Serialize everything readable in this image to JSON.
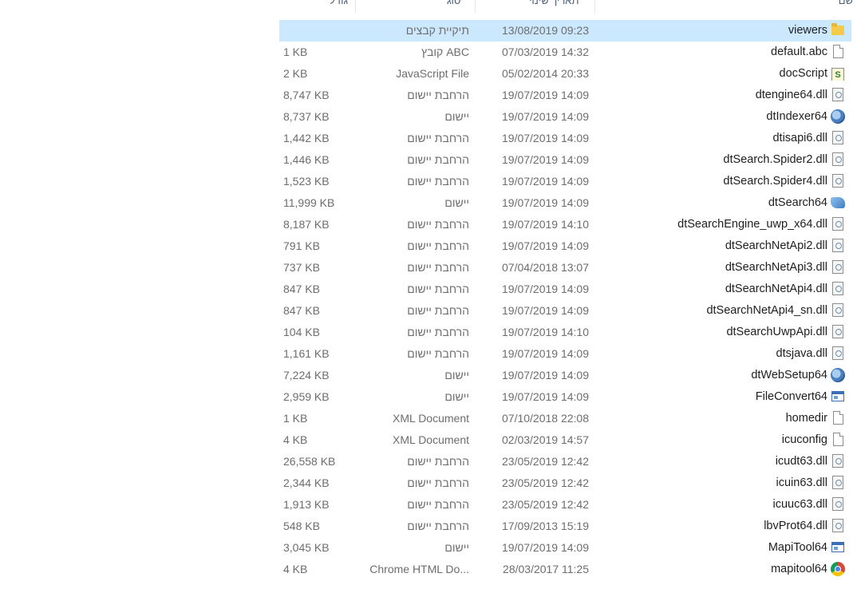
{
  "header": {
    "name": "שם",
    "date_modified": "תאריך שינוי",
    "type": "סוג",
    "size": "גודל"
  },
  "files": [
    {
      "name": "viewers",
      "date": "13/08/2019 09:23",
      "type": "תיקיית קבצים",
      "size": "",
      "icon": "folder-icon",
      "selected": true
    },
    {
      "name": "default.abc",
      "date": "07/03/2019 14:32",
      "type": "קובץ ABC",
      "size": "1 KB",
      "icon": "file-icon"
    },
    {
      "name": "docScript",
      "date": "05/02/2014 20:33",
      "type": "JavaScript File",
      "size": "2 KB",
      "icon": "script-icon"
    },
    {
      "name": "dtengine64.dll",
      "date": "19/07/2019 14:09",
      "type": "הרחבת יישום",
      "size": "8,747 KB",
      "icon": "dll-icon"
    },
    {
      "name": "dtIndexer64",
      "date": "19/07/2019 14:09",
      "type": "יישום",
      "size": "8,737 KB",
      "icon": "gear-app-icon"
    },
    {
      "name": "dtisapi6.dll",
      "date": "19/07/2019 14:09",
      "type": "הרחבת יישום",
      "size": "1,442 KB",
      "icon": "dll-icon"
    },
    {
      "name": "dtSearch.Spider2.dll",
      "date": "19/07/2019 14:09",
      "type": "הרחבת יישום",
      "size": "1,446 KB",
      "icon": "dll-icon"
    },
    {
      "name": "dtSearch.Spider4.dll",
      "date": "19/07/2019 14:09",
      "type": "הרחבת יישום",
      "size": "1,523 KB",
      "icon": "dll-icon"
    },
    {
      "name": "dtSearch64",
      "date": "19/07/2019 14:09",
      "type": "יישום",
      "size": "11,999 KB",
      "icon": "search-app-icon"
    },
    {
      "name": "dtSearchEngine_uwp_x64.dll",
      "date": "19/07/2019 14:10",
      "type": "הרחבת יישום",
      "size": "8,187 KB",
      "icon": "dll-icon"
    },
    {
      "name": "dtSearchNetApi2.dll",
      "date": "19/07/2019 14:09",
      "type": "הרחבת יישום",
      "size": "791 KB",
      "icon": "dll-icon"
    },
    {
      "name": "dtSearchNetApi3.dll",
      "date": "07/04/2018 13:07",
      "type": "הרחבת יישום",
      "size": "737 KB",
      "icon": "dll-icon"
    },
    {
      "name": "dtSearchNetApi4.dll",
      "date": "19/07/2019 14:09",
      "type": "הרחבת יישום",
      "size": "847 KB",
      "icon": "dll-icon"
    },
    {
      "name": "dtSearchNetApi4_sn.dll",
      "date": "19/07/2019 14:09",
      "type": "הרחבת יישום",
      "size": "847 KB",
      "icon": "dll-icon"
    },
    {
      "name": "dtSearchUwpApi.dll",
      "date": "19/07/2019 14:10",
      "type": "הרחבת יישום",
      "size": "104 KB",
      "icon": "dll-icon"
    },
    {
      "name": "dtsjava.dll",
      "date": "19/07/2019 14:09",
      "type": "הרחבת יישום",
      "size": "1,161 KB",
      "icon": "dll-icon"
    },
    {
      "name": "dtWebSetup64",
      "date": "19/07/2019 14:09",
      "type": "יישום",
      "size": "7,224 KB",
      "icon": "gear-app-icon"
    },
    {
      "name": "FileConvert64",
      "date": "19/07/2019 14:09",
      "type": "יישום",
      "size": "2,959 KB",
      "icon": "window-app-icon"
    },
    {
      "name": "homedir",
      "date": "07/10/2018 22:08",
      "type": "XML Document",
      "size": "1 KB",
      "icon": "file-icon"
    },
    {
      "name": "icuconfig",
      "date": "02/03/2019 14:57",
      "type": "XML Document",
      "size": "4 KB",
      "icon": "file-icon"
    },
    {
      "name": "icudt63.dll",
      "date": "23/05/2019 12:42",
      "type": "הרחבת יישום",
      "size": "26,558 KB",
      "icon": "dll-icon"
    },
    {
      "name": "icuin63.dll",
      "date": "23/05/2019 12:42",
      "type": "הרחבת יישום",
      "size": "2,344 KB",
      "icon": "dll-icon"
    },
    {
      "name": "icuuc63.dll",
      "date": "23/05/2019 12:42",
      "type": "הרחבת יישום",
      "size": "1,913 KB",
      "icon": "dll-icon"
    },
    {
      "name": "lbvProt64.dll",
      "date": "17/09/2013 15:19",
      "type": "הרחבת יישום",
      "size": "548 KB",
      "icon": "dll-icon"
    },
    {
      "name": "MapiTool64",
      "date": "19/07/2019 14:09",
      "type": "יישום",
      "size": "3,045 KB",
      "icon": "window-app-icon"
    },
    {
      "name": "mapitool64",
      "date": "28/03/2017 11:25",
      "type": "Chrome HTML Do...",
      "size": "4 KB",
      "icon": "chrome-icon"
    }
  ],
  "colors": {
    "selection": "#cce8ff",
    "header_text": "#4c607a",
    "secondary_text": "#6d6d6d"
  }
}
